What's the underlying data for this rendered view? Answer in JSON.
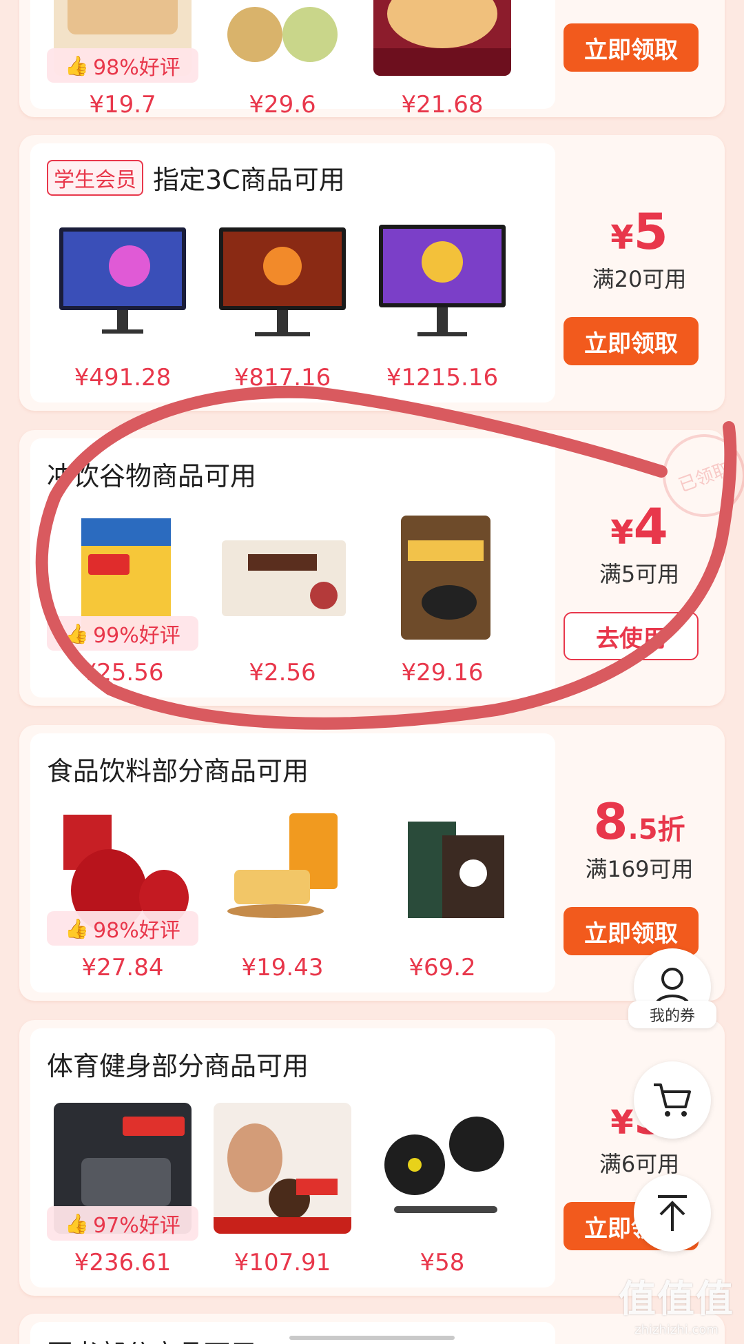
{
  "colors": {
    "accent": "#e8374b",
    "button": "#f25a1d",
    "background": "#fde9e2",
    "annotation_stroke": "#d95a5f"
  },
  "cards": [
    {
      "id": "top",
      "title_tag": "",
      "title": "",
      "products": [
        {
          "price": "¥19.7",
          "rating": "98%好评",
          "icon": "bread"
        },
        {
          "price": "¥29.6",
          "rating": "",
          "icon": "cookies"
        },
        {
          "price": "¥21.68",
          "rating": "",
          "icon": "pastry"
        }
      ],
      "coupon": {
        "currency": "",
        "amount": "",
        "unit": "",
        "condition": ""
      },
      "button": "立即领取",
      "button_style": "filled"
    },
    {
      "id": "3c",
      "title_tag": "学生会员",
      "title": "指定3C商品可用",
      "products": [
        {
          "price": "¥491.28",
          "rating": "",
          "icon": "monitor"
        },
        {
          "price": "¥817.16",
          "rating": "",
          "icon": "monitor"
        },
        {
          "price": "¥1215.16",
          "rating": "",
          "icon": "monitor"
        }
      ],
      "coupon": {
        "currency": "¥",
        "amount": "5",
        "unit": "",
        "condition": "满20可用"
      },
      "button": "立即领取",
      "button_style": "filled"
    },
    {
      "id": "drinks",
      "title_tag": "",
      "title": "冲饮谷物商品可用",
      "products": [
        {
          "price": "¥25.56",
          "rating": "99%好评",
          "icon": "oat-bag"
        },
        {
          "price": "¥2.56",
          "rating": "",
          "icon": "oat-box"
        },
        {
          "price": "¥29.16",
          "rating": "",
          "icon": "sesame-bag"
        }
      ],
      "coupon": {
        "currency": "¥",
        "amount": "4",
        "unit": "",
        "condition": "满5可用"
      },
      "button": "去使用",
      "button_style": "outline",
      "stamp": "已领取"
    },
    {
      "id": "food",
      "title_tag": "",
      "title": "食品饮料部分商品可用",
      "products": [
        {
          "price": "¥27.84",
          "rating": "98%好评",
          "icon": "dates"
        },
        {
          "price": "¥19.43",
          "rating": "",
          "icon": "rice-cake"
        },
        {
          "price": "¥69.2",
          "rating": "",
          "icon": "coffee"
        }
      ],
      "coupon": {
        "currency": "",
        "amount": "8",
        "unit": ".5折",
        "condition": "满169可用"
      },
      "button": "立即领取",
      "button_style": "filled"
    },
    {
      "id": "sports",
      "title_tag": "",
      "title": "体育健身部分商品可用",
      "products": [
        {
          "price": "¥236.61",
          "rating": "97%好评",
          "icon": "jump-rope"
        },
        {
          "price": "¥107.91",
          "rating": "",
          "icon": "ab-roller"
        },
        {
          "price": "¥58",
          "rating": "",
          "icon": "dumbbell"
        }
      ],
      "coupon": {
        "currency": "¥",
        "amount": "5",
        "unit": "",
        "condition": "满6可用"
      },
      "button": "立即领取",
      "button_style": "filled"
    },
    {
      "id": "books",
      "title_tag": "",
      "title": "图书部分商品可用",
      "products": [],
      "coupon": {
        "currency": "",
        "amount": "",
        "unit": "",
        "condition": ""
      },
      "button": "",
      "button_style": "filled"
    }
  ],
  "fabs": {
    "my_coupons_label": "我的券",
    "cart_icon": "cart-icon",
    "top_icon": "back-to-top-icon"
  },
  "watermark": {
    "main": "值值值",
    "sub": "zhizhizhi.com"
  }
}
